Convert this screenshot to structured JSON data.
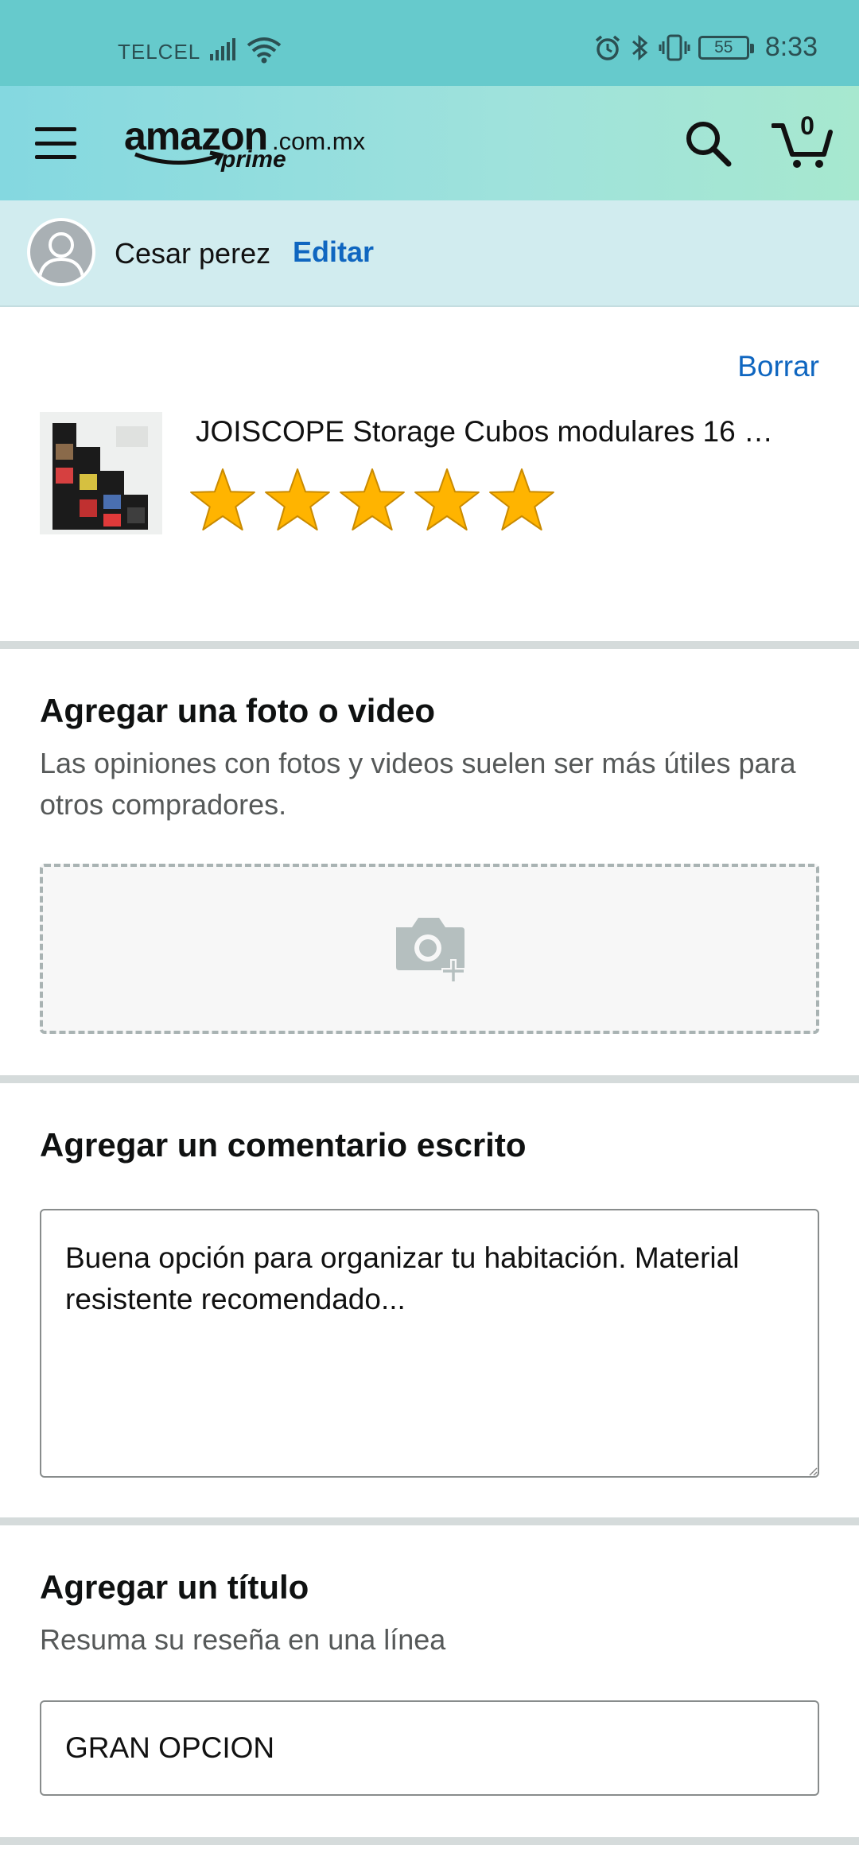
{
  "status_bar": {
    "carrier": "TELCEL",
    "battery": "55",
    "time": "8:33"
  },
  "header": {
    "logo_main": "amazon",
    "logo_domain": ".com.mx",
    "logo_sub": "prime",
    "cart_count": "0"
  },
  "profile": {
    "name": "Cesar perez",
    "edit_label": "Editar"
  },
  "product": {
    "delete_label": "Borrar",
    "title": "JOISCOPE Storage Cubos modulares 16 …",
    "rating": 5,
    "rating_max": 5
  },
  "photo_section": {
    "heading": "Agregar una foto o video",
    "subtext": "Las opiniones con fotos y videos suelen ser más útiles para otros compradores."
  },
  "comment_section": {
    "heading": "Agregar un comentario escrito",
    "value": "Buena opción para organizar tu habitación. Material resistente recomendado..."
  },
  "title_section": {
    "heading": "Agregar un título",
    "subtext": "Resuma su reseña en una línea",
    "value": "GRAN OPCION"
  },
  "colors": {
    "status_bar": "#66cacc",
    "header_start": "#84d8e0",
    "header_end": "#a7e8cf",
    "profile_bg": "#d1ecef",
    "link": "#0f66c0",
    "star": "#ffb400"
  }
}
